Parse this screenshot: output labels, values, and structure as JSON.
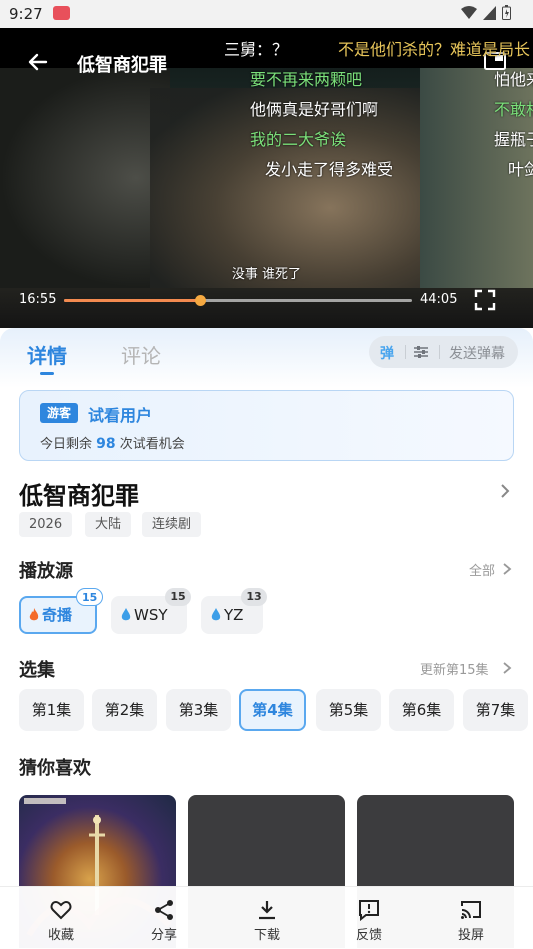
{
  "status_bar": {
    "time": "9:27"
  },
  "player": {
    "title": "低智商犯罪",
    "danmaku": [
      {
        "text": "三舅：？",
        "color": "#ffffff"
      },
      {
        "text": "不是他们杀的？难道是局长",
        "color": "#e7c55a"
      },
      {
        "text": "要不再来两颗吧",
        "color": "#7be07a"
      },
      {
        "text": "怕他来",
        "color": "#ffffff"
      },
      {
        "text": "他俩真是好哥们啊",
        "color": "#ffffff"
      },
      {
        "text": "不敢相",
        "color": "#7be07a"
      },
      {
        "text": "我的二大爷诶",
        "color": "#7be07a"
      },
      {
        "text": "握瓶子",
        "color": "#ffffff"
      },
      {
        "text": "发小走了得多难受",
        "color": "#ffffff"
      },
      {
        "text": "叶剑",
        "color": "#ffffff"
      }
    ],
    "subtitle": "没事 谁死了",
    "current_time": "16:55",
    "duration": "44:05",
    "progress": 0.39
  },
  "tabs": {
    "detail": "详情",
    "comment": "评论"
  },
  "danmaku_controls": {
    "toggle": "弹",
    "send_placeholder": "发送弹幕"
  },
  "guest": {
    "badge": "游客",
    "name": "试看用户",
    "quota_prefix": "今日剩余",
    "quota_count": "98",
    "quota_suffix": "次试看机会"
  },
  "show": {
    "title": "低智商犯罪",
    "tags": [
      "2026",
      "大陆",
      "连续剧"
    ]
  },
  "sources": {
    "title": "播放源",
    "more": "全部",
    "items": [
      {
        "name": "奇播",
        "count": "15",
        "icon": "fire-icon",
        "active": true
      },
      {
        "name": "WSY",
        "count": "15",
        "icon": "drop-icon",
        "active": false
      },
      {
        "name": "YZ",
        "count": "13",
        "icon": "drop-icon",
        "active": false
      }
    ]
  },
  "episodes": {
    "title": "选集",
    "more": "更新第15集",
    "items": [
      "第1集",
      "第2集",
      "第3集",
      "第4集",
      "第5集",
      "第6集",
      "第7集"
    ],
    "active": "第4集"
  },
  "recommend": {
    "title": "猜你喜欢"
  },
  "bottom_bar": {
    "favorite": "收藏",
    "share": "分享",
    "download": "下载",
    "feedback": "反馈",
    "cast": "投屏"
  },
  "colors": {
    "accent": "#2e86de",
    "progress": "#f48b50"
  }
}
